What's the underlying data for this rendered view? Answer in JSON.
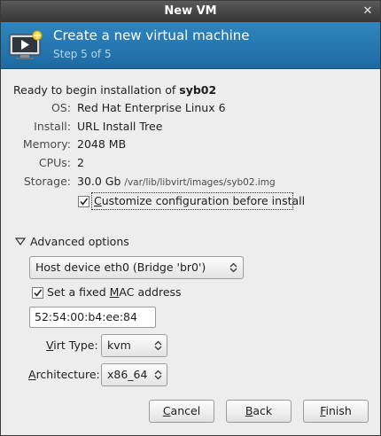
{
  "window": {
    "title": "New VM"
  },
  "header": {
    "title": "Create a new virtual machine",
    "step": "Step 5 of 5"
  },
  "summary": {
    "ready_prefix": "Ready to begin installation of ",
    "vm_name": "syb02",
    "rows": [
      {
        "label": "OS:",
        "value": "Red Hat Enterprise Linux 6"
      },
      {
        "label": "Install:",
        "value": "URL Install Tree"
      },
      {
        "label": "Memory:",
        "value": "2048 MB"
      },
      {
        "label": "CPUs:",
        "value": "2"
      },
      {
        "label": "Storage:",
        "value": "30.0 Gb",
        "path": "/var/lib/libvirt/images/syb02.img"
      }
    ],
    "customize": {
      "pre": "",
      "mnemonic": "C",
      "post": "ustomize configuration before install",
      "checked": true
    }
  },
  "advanced": {
    "label": "Advanced options",
    "expanded": true,
    "network": "Host device eth0 (Bridge 'br0')",
    "fixed_mac": {
      "pre": "Set a fixed ",
      "mnemonic": "M",
      "post": "AC address",
      "checked": true
    },
    "mac_value": "52:54:00:b4:ee:84",
    "virt_type": {
      "pre": "",
      "mnemonic": "V",
      "post": "irt Type:",
      "value": "kvm"
    },
    "architecture": {
      "pre": "",
      "mnemonic": "A",
      "post": "rchitecture:",
      "value": "x86_64"
    }
  },
  "buttons": {
    "cancel": {
      "pre": "",
      "mnemonic": "C",
      "post": "ancel"
    },
    "back": {
      "pre": "",
      "mnemonic": "B",
      "post": "ack"
    },
    "finish": {
      "pre": "",
      "mnemonic": "F",
      "post": "inish"
    }
  }
}
